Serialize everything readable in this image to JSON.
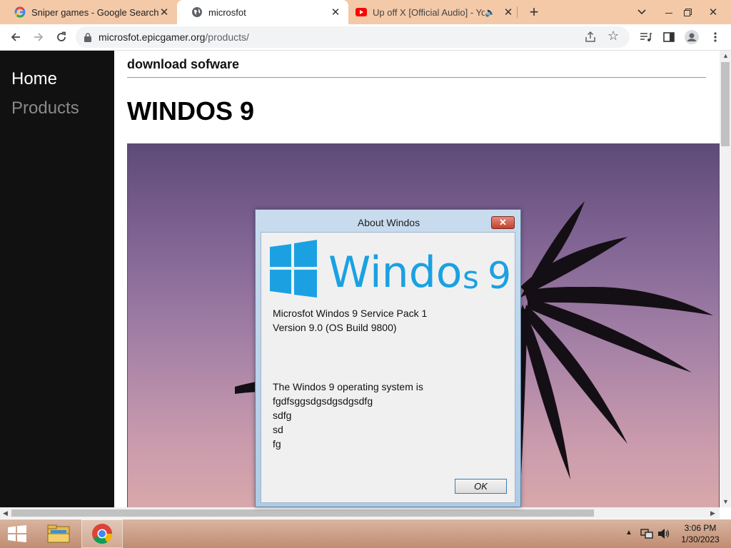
{
  "browser": {
    "tabs": [
      {
        "title": "Sniper games - Google Search",
        "icon": "google-icon"
      },
      {
        "title": "microsfot",
        "icon": "globe-icon"
      },
      {
        "title": "Up off X [Official Audio] - Yo",
        "icon": "youtube-icon"
      }
    ],
    "url_host": "microsfot.epicgamer.org",
    "url_path": "/products/"
  },
  "page": {
    "nav": [
      {
        "label": "Home"
      },
      {
        "label": "Products"
      }
    ],
    "subheading": "download sofware",
    "title": "WINDOS 9"
  },
  "dialog": {
    "title": "About Windos",
    "logo_text_left": "Windo",
    "logo_text_right": "s",
    "logo_number": "9",
    "line1": "Microsfot Windos 9 Service Pack 1",
    "line2": "Version 9.0 (OS Build 9800)",
    "line3": "The Windos 9 operating system is",
    "line4": "fgdfsggsdgsdgsdgsdfg",
    "line5": "sdfg",
    "line6": "sd",
    "line7": "fg",
    "ok_label": "OK"
  },
  "taskbar": {
    "time": "3:06 PM",
    "date": "1/30/2023"
  },
  "colors": {
    "tabstrip": "#f3c9a8",
    "windows_blue": "#1ba1e2",
    "sidebar": "#111111"
  }
}
